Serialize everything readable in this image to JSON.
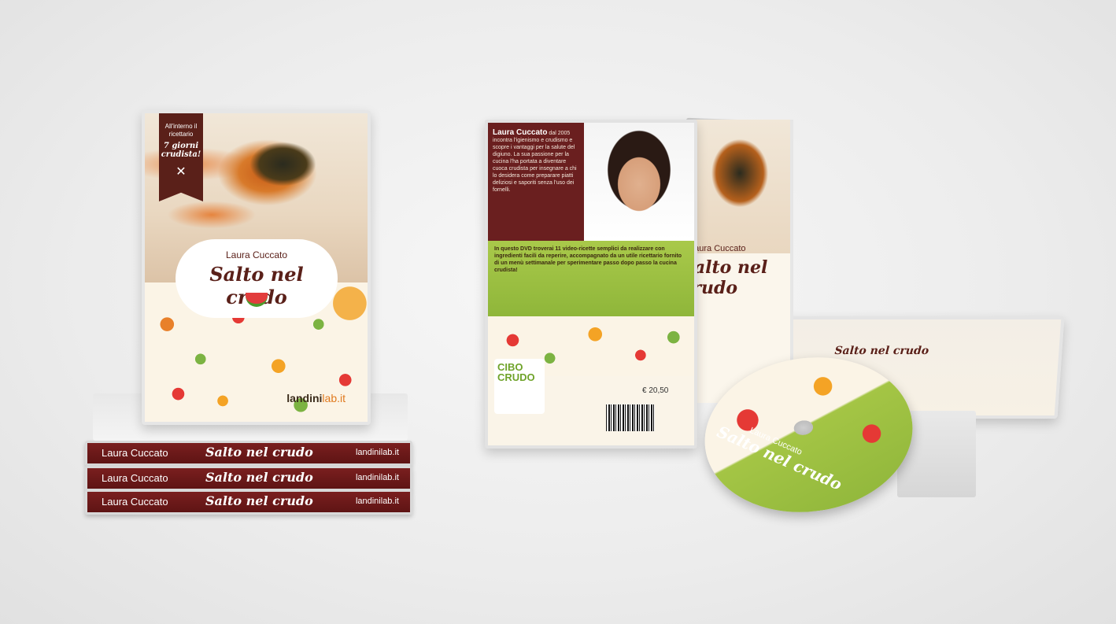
{
  "product": {
    "author": "Laura Cuccato",
    "title": "Salto nel crudo",
    "publisher_main": "landini",
    "publisher_suffix": "lab.it"
  },
  "ribbon": {
    "line1": "All'interno il ricettario",
    "line2": "7 giorni crudista!"
  },
  "back": {
    "bio_name": "Laura Cuccato",
    "bio_text": "dal 2005 incontra l'igienismo e crudismo e scopre i vantaggi per la salute del digiuno. La sua passione per la cucina l'ha portata a diventare cuoca crudista per insegnare a chi lo desidera come preparare piatti deliziosi e saporiti senza l'uso dei fornelli.",
    "green_text": "In questo DVD troverai 11 video-ricette semplici da realizzare con ingredienti facili da reperire, accompagnato da un utile ricettario fornito di un menù settimanale per sperimentare passo dopo passo la cucina crudista!",
    "brand_top": "CIBO",
    "brand_bottom": "CRUDO",
    "price": "€ 20,50"
  }
}
